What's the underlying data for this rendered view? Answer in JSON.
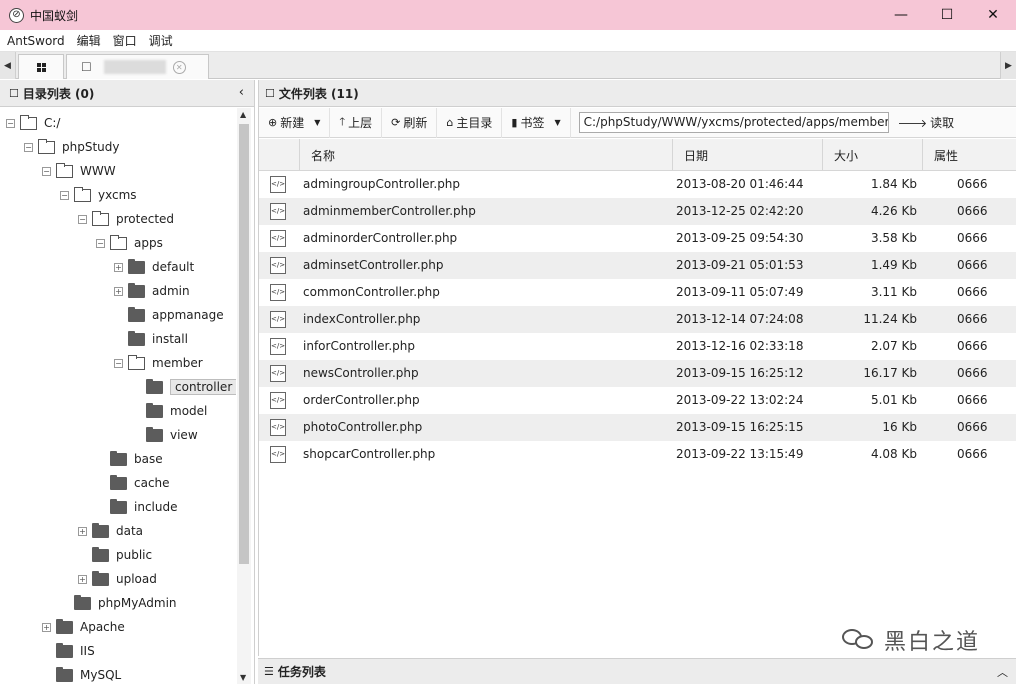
{
  "window": {
    "title": "中国蚁剑",
    "minimize": "—",
    "maximize": "☐",
    "close": "✕"
  },
  "menu": [
    "AntSword",
    "编辑",
    "窗口",
    "调试"
  ],
  "left_panel": {
    "title": "目录列表 (0)",
    "tree": [
      {
        "label": "C:/",
        "state": "open",
        "expander": "−"
      },
      {
        "label": "phpStudy",
        "state": "open",
        "expander": "−"
      },
      {
        "label": "WWW",
        "state": "open",
        "expander": "−"
      },
      {
        "label": "yxcms",
        "state": "open",
        "expander": "−"
      },
      {
        "label": "protected",
        "state": "open",
        "expander": "−"
      },
      {
        "label": "apps",
        "state": "open",
        "expander": "−"
      },
      {
        "label": "default",
        "state": "closed",
        "expander": "+"
      },
      {
        "label": "admin",
        "state": "closed",
        "expander": "+"
      },
      {
        "label": "appmanage",
        "state": "closed",
        "expander": ""
      },
      {
        "label": "install",
        "state": "closed",
        "expander": ""
      },
      {
        "label": "member",
        "state": "open",
        "expander": "−"
      },
      {
        "label": "controller",
        "state": "closed",
        "expander": "",
        "selected": true
      },
      {
        "label": "model",
        "state": "closed",
        "expander": ""
      },
      {
        "label": "view",
        "state": "closed",
        "expander": ""
      },
      {
        "label": "base",
        "state": "closed",
        "expander": ""
      },
      {
        "label": "cache",
        "state": "closed",
        "expander": ""
      },
      {
        "label": "include",
        "state": "closed",
        "expander": ""
      },
      {
        "label": "data",
        "state": "closed",
        "expander": "+"
      },
      {
        "label": "public",
        "state": "closed",
        "expander": ""
      },
      {
        "label": "upload",
        "state": "closed",
        "expander": "+"
      },
      {
        "label": "phpMyAdmin",
        "state": "closed",
        "expander": ""
      },
      {
        "label": "Apache",
        "state": "closed",
        "expander": "+"
      },
      {
        "label": "IIS",
        "state": "closed",
        "expander": ""
      },
      {
        "label": "MySQL",
        "state": "closed",
        "expander": ""
      }
    ]
  },
  "right_panel": {
    "title": "文件列表 (11)",
    "toolbar": {
      "new": "新建",
      "up": "上层",
      "refresh": "刷新",
      "home": "主目录",
      "bookmark": "书签",
      "path": "C:/phpStudy/WWW/yxcms/protected/apps/member/controller/",
      "read": "读取"
    },
    "columns": [
      "名称",
      "日期",
      "大小",
      "属性"
    ],
    "files": [
      {
        "name": "admingroupController.php",
        "date": "2013-08-20 01:46:44",
        "size": "1.84 Kb",
        "perm": "0666"
      },
      {
        "name": "adminmemberController.php",
        "date": "2013-12-25 02:42:20",
        "size": "4.26 Kb",
        "perm": "0666"
      },
      {
        "name": "adminorderController.php",
        "date": "2013-09-25 09:54:30",
        "size": "3.58 Kb",
        "perm": "0666"
      },
      {
        "name": "adminsetController.php",
        "date": "2013-09-21 05:01:53",
        "size": "1.49 Kb",
        "perm": "0666"
      },
      {
        "name": "commonController.php",
        "date": "2013-09-11 05:07:49",
        "size": "3.11 Kb",
        "perm": "0666"
      },
      {
        "name": "indexController.php",
        "date": "2013-12-14 07:24:08",
        "size": "11.24 Kb",
        "perm": "0666"
      },
      {
        "name": "inforController.php",
        "date": "2013-12-16 02:33:18",
        "size": "2.07 Kb",
        "perm": "0666"
      },
      {
        "name": "newsController.php",
        "date": "2013-09-15 16:25:12",
        "size": "16.17 Kb",
        "perm": "0666"
      },
      {
        "name": "orderController.php",
        "date": "2013-09-22 13:02:24",
        "size": "5.01 Kb",
        "perm": "0666"
      },
      {
        "name": "photoController.php",
        "date": "2013-09-15 16:25:15",
        "size": "16 Kb",
        "perm": "0666"
      },
      {
        "name": "shopcarController.php",
        "date": "2013-09-22 13:15:49",
        "size": "4.08 Kb",
        "perm": "0666"
      }
    ]
  },
  "task_panel": {
    "title": "任务列表"
  },
  "watermark": "黑白之道"
}
